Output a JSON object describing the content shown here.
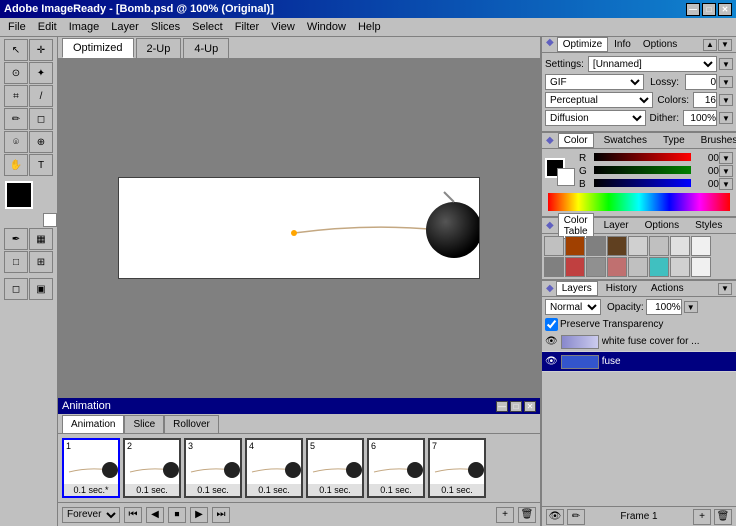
{
  "window": {
    "title": "Adobe ImageReady - [Bomb.psd @ 100% (Original)]",
    "title_short": "Adobe ImageReady - [Bomb.psd @ 100% (Original)]"
  },
  "titlebar": {
    "close_label": "✕",
    "minimize_label": "—",
    "maximize_label": "□"
  },
  "menubar": {
    "items": [
      "File",
      "Edit",
      "Image",
      "Layer",
      "Slices",
      "Select",
      "Filter",
      "View",
      "Window",
      "Help"
    ]
  },
  "tabs": {
    "items": [
      "Optimized",
      "2-Up",
      "4-Up"
    ],
    "active": "Optimized"
  },
  "optimize_panel": {
    "title": "Optimize",
    "tab_info": "Info",
    "tab_options": "Options",
    "settings_label": "Settings:",
    "settings_value": "[Unnamed]",
    "format_value": "GIF",
    "lossy_label": "Lossy:",
    "lossy_value": "0",
    "palette_label": "Perceptual",
    "colors_label": "Colors:",
    "colors_value": "16",
    "dither_label": "Diffusion",
    "dither_pct_label": "Dither:",
    "dither_pct_value": "100%"
  },
  "color_panel": {
    "title": "Color",
    "tab_swatches": "Swatches",
    "tab_type": "Type",
    "tab_brushes": "Brushes",
    "r_label": "R",
    "r_value": "00",
    "g_label": "G",
    "g_value": "00",
    "b_label": "B",
    "b_value": "00"
  },
  "styles_panel": {
    "title": "Color Table",
    "tab_layer": "Layer",
    "tab_options": "Options",
    "tab_styles": "Styles",
    "swatches": [
      "#c0c0c0",
      "#a04000",
      "#808080",
      "#604020",
      "#c0c0c0",
      "#c0c0c0",
      "#c0c0c0",
      "#c0c0c0",
      "#808080",
      "#c04040",
      "#808080",
      "#c06060",
      "#c0c0c0",
      "#40c0c0",
      "#c0c0c0",
      "#c0c0c0"
    ]
  },
  "layers_panel": {
    "title": "Layers",
    "tab_history": "History",
    "tab_actions": "Actions",
    "mode_label": "Normal",
    "opacity_label": "Opacity:",
    "opacity_value": "100%",
    "preserve_label": "Preserve Transparency",
    "layers": [
      {
        "name": "white fuse cover for ...",
        "icon_color": "#8888cc",
        "selected": false
      },
      {
        "name": "fuse",
        "icon_color": "#3355cc",
        "selected": true
      }
    ],
    "footer_left": "⚙",
    "footer_frame": "Frame 1"
  },
  "animation_panel": {
    "title": "Animation",
    "tab_slice": "Slice",
    "tab_rollover": "Rollover",
    "frames": [
      {
        "number": "1",
        "time": "0.1 sec.*",
        "selected": true,
        "has_line": true
      },
      {
        "number": "2",
        "time": "0.1 sec.",
        "selected": false,
        "has_line": true
      },
      {
        "number": "3",
        "time": "0.1 sec.",
        "selected": false,
        "has_line": true
      },
      {
        "number": "4",
        "time": "0.1 sec.",
        "selected": false,
        "has_line": true
      },
      {
        "number": "5",
        "time": "0.1 sec.",
        "selected": false,
        "has_line": true
      },
      {
        "number": "6",
        "time": "0.1 sec.",
        "selected": false,
        "has_line": true
      },
      {
        "number": "7",
        "time": "0.1 sec.",
        "selected": false,
        "has_line": true
      }
    ],
    "loop_value": "Forever",
    "controls": [
      "⏮",
      "◀",
      "⏹",
      "▶",
      "⏭"
    ]
  },
  "tools": [
    {
      "name": "select-tool",
      "icon": "↖"
    },
    {
      "name": "move-tool",
      "icon": "✛"
    },
    {
      "name": "lasso-tool",
      "icon": "⊙"
    },
    {
      "name": "magic-wand-tool",
      "icon": "✦"
    },
    {
      "name": "crop-tool",
      "icon": "⌗"
    },
    {
      "name": "slice-tool",
      "icon": "/"
    },
    {
      "name": "brush-tool",
      "icon": "✏"
    },
    {
      "name": "eraser-tool",
      "icon": "◻"
    },
    {
      "name": "eyedropper-tool",
      "icon": "⌾"
    },
    {
      "name": "zoom-tool",
      "icon": "⊕"
    },
    {
      "name": "hand-tool",
      "icon": "✋"
    },
    {
      "name": "type-tool",
      "icon": "T"
    },
    {
      "name": "pen-tool",
      "icon": "✒"
    },
    {
      "name": "gradient-tool",
      "icon": "▦"
    },
    {
      "name": "rectangle-tool",
      "icon": "□"
    },
    {
      "name": "zoom2-tool",
      "icon": "⊞"
    }
  ]
}
